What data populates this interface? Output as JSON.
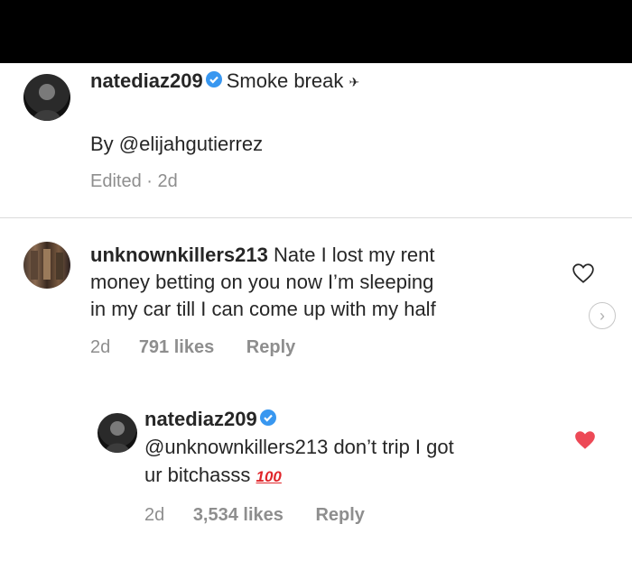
{
  "post": {
    "username": "natediaz209",
    "caption": "Smoke break",
    "caption_emoji": "✈",
    "credit": "By @elijahgutierrez",
    "edited": "Edited · 2d"
  },
  "comment": {
    "username": "unknownkillers213",
    "line1": "Nate I lost my rent",
    "line2": "money betting on you now I’m sleeping",
    "line3": "in my car till I can come up with my half",
    "time": "2d",
    "likes": "791 likes",
    "reply": "Reply"
  },
  "reply_comment": {
    "username": "natediaz209",
    "line1": "@unknownkillers213 don’t trip I got",
    "line2": "ur bitchasss",
    "emoji": "100",
    "time": "2d",
    "likes": "3,534 likes",
    "reply": "Reply"
  },
  "icons": {
    "verified": "verified-badge-icon",
    "heart_outline": "heart-outline-icon",
    "heart_filled": "heart-filled-icon",
    "chevron": "chevron-right-icon"
  },
  "colors": {
    "verified": "#3897f0",
    "liked_heart": "#ed4956",
    "muted_text": "#8e8e8e"
  }
}
